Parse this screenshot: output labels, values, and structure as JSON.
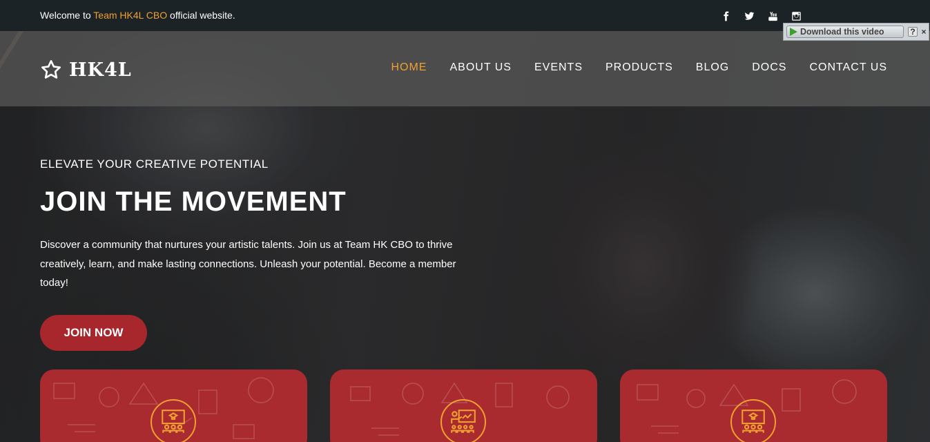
{
  "topbar": {
    "welcome_prefix": "Welcome to ",
    "welcome_brand": "Team HK4L CBO",
    "welcome_suffix": " official website.",
    "socials": [
      "facebook-icon",
      "twitter-icon",
      "youtube-icon",
      "instagram-icon"
    ]
  },
  "download_overlay": {
    "label": "Download this video",
    "help": "?",
    "close": "×"
  },
  "nav": {
    "logo_text": "HK4L",
    "items": [
      {
        "label": "HOME",
        "active": true
      },
      {
        "label": "ABOUT US",
        "active": false
      },
      {
        "label": "EVENTS",
        "active": false
      },
      {
        "label": "PRODUCTS",
        "active": false
      },
      {
        "label": "BLOG",
        "active": false
      },
      {
        "label": "DOCS",
        "active": false
      },
      {
        "label": "CONTACT US",
        "active": false
      }
    ]
  },
  "hero": {
    "kicker": "ELEVATE YOUR CREATIVE POTENTIAL",
    "headline": "JOIN THE MOVEMENT",
    "description": "Discover a community that nurtures your artistic talents. Join us at Team HK CBO to thrive creatively, learn, and make lasting connections. Unleash your potential. Become a member today!",
    "cta_label": "JOIN NOW"
  },
  "cards": [
    {
      "icon": "presentation-board-icon"
    },
    {
      "icon": "teacher-class-icon"
    },
    {
      "icon": "presentation-board-icon"
    }
  ],
  "colors": {
    "accent": "#f0a030",
    "brand_red": "#a92a2f",
    "topbar": "#1c2326"
  }
}
